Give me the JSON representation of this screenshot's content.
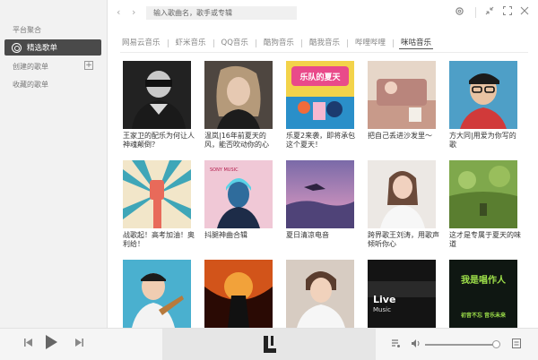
{
  "sidebar": {
    "platform_label": "平台聚合",
    "active_item": "精选歌单",
    "created_label": "创建的歌单",
    "add_symbol": "+",
    "collected_label": "收藏的歌单"
  },
  "topbar": {
    "search_placeholder": "输入歌曲名，歌手或专辑",
    "back_icon": "chevron-left-icon",
    "forward_icon": "chevron-right-icon"
  },
  "tabs": [
    {
      "label": "网易云音乐",
      "active": false
    },
    {
      "label": "虾米音乐",
      "active": false
    },
    {
      "label": "QQ音乐",
      "active": false
    },
    {
      "label": "酷狗音乐",
      "active": false
    },
    {
      "label": "酷我音乐",
      "active": false
    },
    {
      "label": "哔哩哔哩",
      "active": false
    },
    {
      "label": "咪咕音乐",
      "active": true
    }
  ],
  "playlists": [
    {
      "caption": "王家卫的配乐为何让人神魂颠倒？",
      "cover_color": "#1a1a1a"
    },
    {
      "caption": "温岚|16年前夏天的风，能否吹动你的心",
      "cover_color": "#5a5048"
    },
    {
      "caption": "乐夏2来袭，即将承包这个夏天！",
      "cover_color": "#e94a8a"
    },
    {
      "caption": "把自己丢进沙发里～",
      "cover_color": "#d9b9a5"
    },
    {
      "caption": "方大同|用爱为你写的歌",
      "cover_color": "#5aa3c8"
    },
    {
      "caption": "战歌起！高考加油！奥利给！",
      "cover_color": "#3fa6b8"
    },
    {
      "caption": "抖腿神曲合辑",
      "cover_color": "#3a6fa0"
    },
    {
      "caption": "夏日清凉电音",
      "cover_color": "#7f6aa6"
    },
    {
      "caption": "跨界歌王刘涛，用歌声倾听你心",
      "cover_color": "#e8e4e0"
    },
    {
      "caption": "这才是专属于夏天的味道",
      "cover_color": "#6b8f3e"
    },
    {
      "caption": "",
      "cover_color": "#4ab0cf"
    },
    {
      "caption": "",
      "cover_color": "#c23a10"
    },
    {
      "caption": "",
      "cover_color": "#c9bfb5"
    },
    {
      "caption": "",
      "cover_color": "#1a1a1a"
    },
    {
      "caption": "",
      "cover_color": "#111a14"
    }
  ],
  "cover_texts": {
    "summer_title": "乐队的夏天",
    "sony_label": "SONY MUSIC",
    "live_title": "Live",
    "live_sub": "Music",
    "zuoren_title": "我是唱作人",
    "zuoren_sub": "初音不忘 音乐未来"
  },
  "player": {
    "prev_icon": "prev-track-icon",
    "play_icon": "play-icon",
    "next_icon": "next-track-icon",
    "playlist_icon": "playlist-icon",
    "volume_icon": "volume-icon",
    "volume_level": 0.95,
    "lyric_icon": "lyric-icon"
  },
  "colors": {
    "sidebar_bg": "#f2f2f2",
    "active_bg": "#4a4a4a",
    "player_bg": "#f5f5f5",
    "player_center_bg": "#e6e6e6"
  }
}
